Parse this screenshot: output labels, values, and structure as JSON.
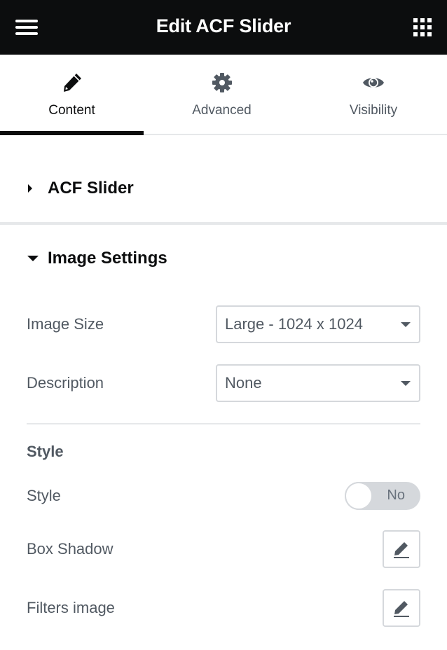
{
  "header": {
    "title": "Edit ACF Slider",
    "menu_icon": "hamburger-menu-icon",
    "apps_icon": "grid-apps-icon"
  },
  "tabs": [
    {
      "label": "Content",
      "icon": "pencil-icon",
      "active": true
    },
    {
      "label": "Advanced",
      "icon": "gear-icon",
      "active": false
    },
    {
      "label": "Visibility",
      "icon": "eye-icon",
      "active": false
    }
  ],
  "sections": {
    "acf_slider": {
      "title": "ACF Slider",
      "expanded": false
    },
    "image_settings": {
      "title": "Image Settings",
      "expanded": true,
      "image_size": {
        "label": "Image Size",
        "value": "Large - 1024 x 1024"
      },
      "description": {
        "label": "Description",
        "value": "None"
      },
      "style_heading": "Style",
      "style": {
        "label": "Style",
        "toggle_text": "No",
        "on": false
      },
      "box_shadow": {
        "label": "Box Shadow",
        "icon": "edit-pencil-icon"
      },
      "filters_image": {
        "label": "Filters image",
        "icon": "edit-pencil-icon"
      }
    }
  },
  "colors": {
    "header_bg": "#0c0d0e",
    "text_primary": "#0c0d0e",
    "text_secondary": "#515962",
    "border": "#d5d8dc",
    "divider": "#e6e8ea"
  }
}
